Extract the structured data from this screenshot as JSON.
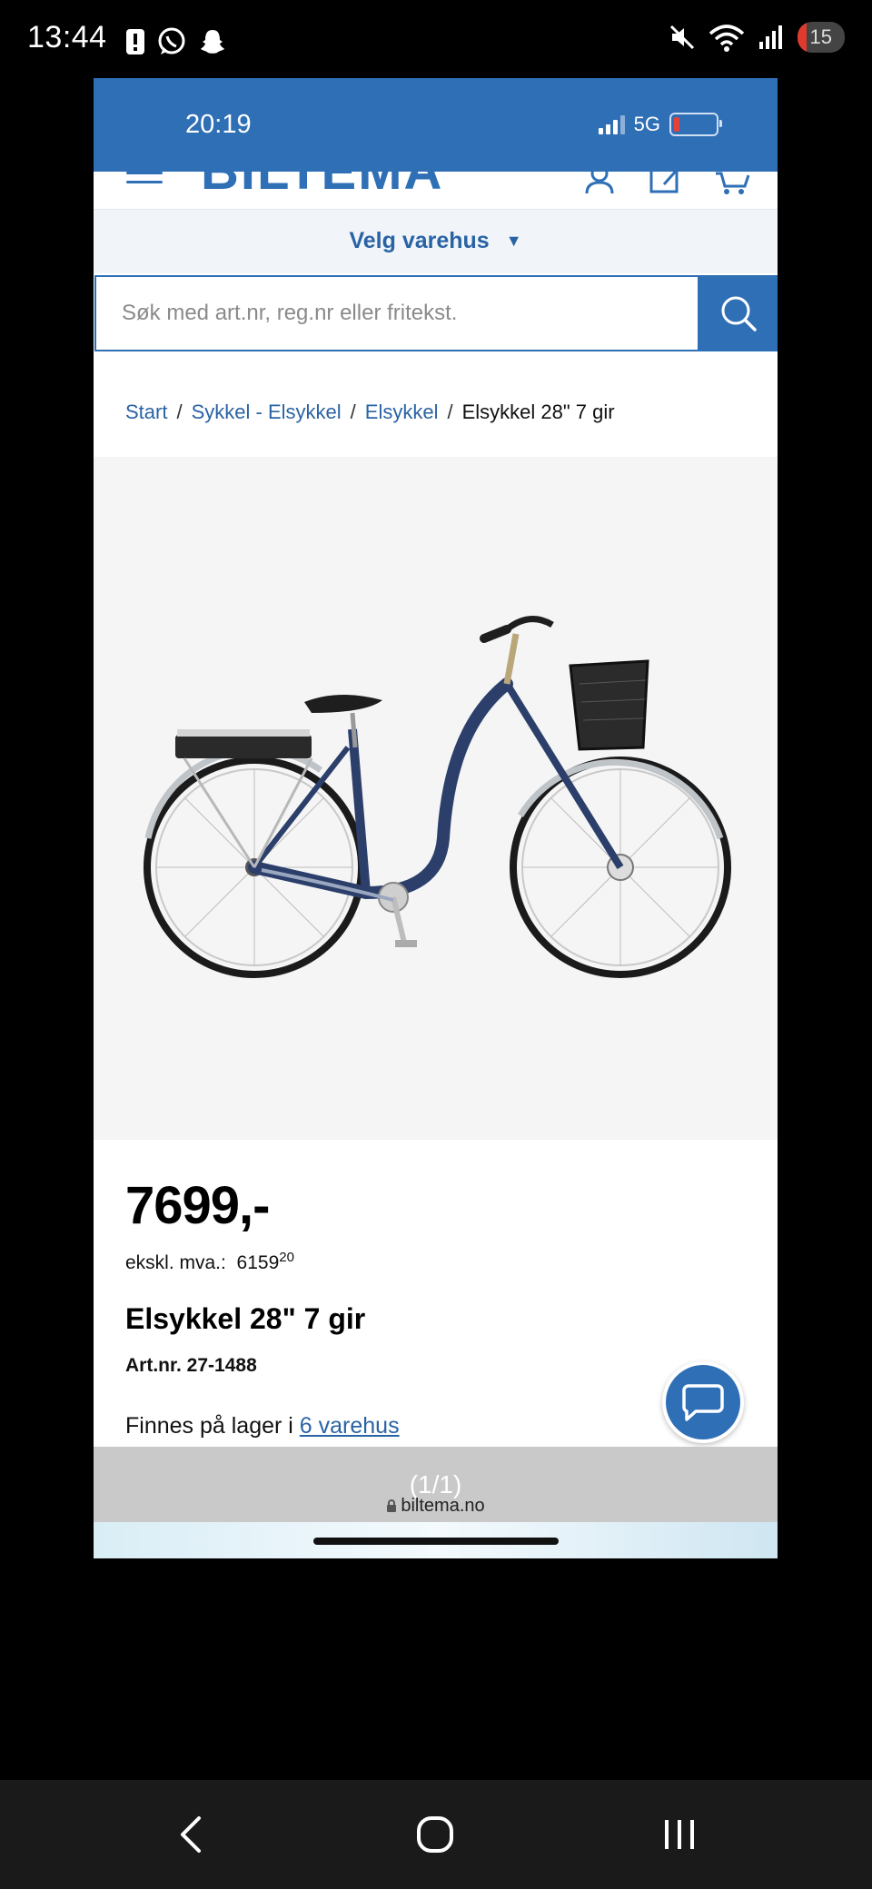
{
  "android_status": {
    "time": "13:44",
    "battery": "15"
  },
  "ios_status": {
    "time": "20:19",
    "network": "5G"
  },
  "header": {
    "logo": "BILTEMA"
  },
  "store_selector": {
    "label": "Velg varehus",
    "caret": "▼"
  },
  "search": {
    "placeholder": "Søk med art.nr, reg.nr eller fritekst."
  },
  "breadcrumb": {
    "items": [
      "Start",
      "Sykkel - Elsykkel",
      "Elsykkel"
    ],
    "current": "Elsykkel 28\" 7 gir",
    "separator": "/"
  },
  "product": {
    "price": "7699,-",
    "vat_label": "ekskl. mva.:",
    "vat_value": "6159",
    "vat_cents": "20",
    "name": "Elsykkel 28\" 7 gir",
    "art_nr": "Art.nr. 27-1488",
    "stock_text": "Finnes på lager i",
    "stock_link": "6 varehus"
  },
  "browser": {
    "page_indicator": "(1/1)",
    "url": "biltema.no"
  },
  "colors": {
    "brand": "#2f6fb6",
    "link": "#2a63a4"
  }
}
